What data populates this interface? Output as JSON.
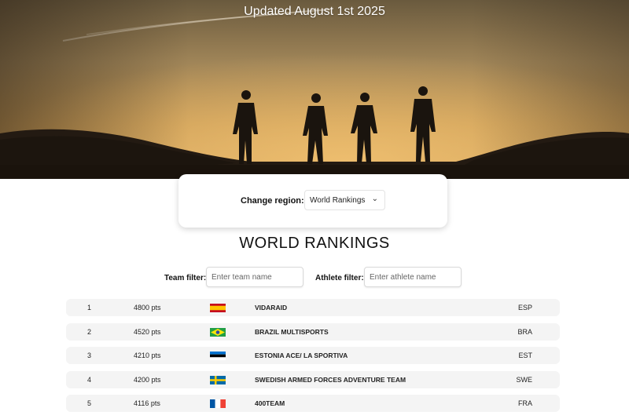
{
  "hero": {
    "updated_text": "Updated August 1st 2025"
  },
  "region": {
    "label": "Change region:",
    "selected": "World Rankings"
  },
  "page_title": "WORLD RANKINGS",
  "filters": {
    "team_label": "Team filter:",
    "team_placeholder": "Enter team name",
    "athlete_label": "Athlete filter:",
    "athlete_placeholder": "Enter athlete name"
  },
  "rankings": [
    {
      "rank": "1",
      "points": "4800 pts",
      "flag": "spain-flag-icon",
      "team": "VIDARAID",
      "code": "ESP"
    },
    {
      "rank": "2",
      "points": "4520 pts",
      "flag": "brazil-flag-icon",
      "team": "BRAZIL MULTISPORTS",
      "code": "BRA"
    },
    {
      "rank": "3",
      "points": "4210 pts",
      "flag": "estonia-flag-icon",
      "team": "ESTONIA ACE/ LA SPORTIVA",
      "code": "EST"
    },
    {
      "rank": "4",
      "points": "4200 pts",
      "flag": "sweden-flag-icon",
      "team": "SWEDISH ARMED FORCES ADVENTURE TEAM",
      "code": "SWE"
    },
    {
      "rank": "5",
      "points": "4116 pts",
      "flag": "france-flag-icon",
      "team": "400TEAM",
      "code": "FRA"
    }
  ]
}
